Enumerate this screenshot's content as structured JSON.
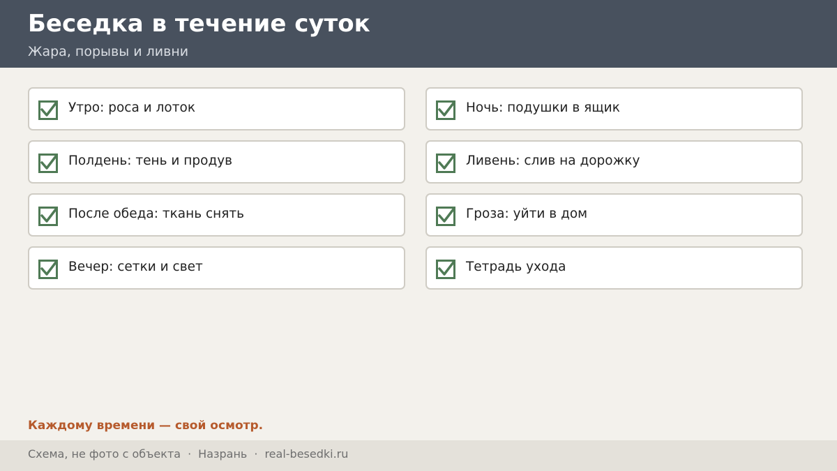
{
  "header": {
    "title": "Беседка в течение суток",
    "subtitle": "Жара, порывы и ливни"
  },
  "checklist": {
    "left": [
      {
        "label": "Утро: роса и лоток",
        "checked": true
      },
      {
        "label": "Полдень: тень и продув",
        "checked": true
      },
      {
        "label": "После обеда: ткань снять",
        "checked": true
      },
      {
        "label": "Вечер: сетки и свет",
        "checked": true
      }
    ],
    "right": [
      {
        "label": "Ночь: подушки в ящик",
        "checked": true
      },
      {
        "label": "Ливень: слив на дорожку",
        "checked": true
      },
      {
        "label": "Гроза: уйти в дом",
        "checked": true
      },
      {
        "label": "Тетрадь ухода",
        "checked": true
      }
    ]
  },
  "slogan": "Каждому времени — свой осмотр.",
  "footer": {
    "note": "Схема, не фото с объекта",
    "separator": "·",
    "city": "Назрань",
    "site": "real-besedki.ru"
  },
  "colors": {
    "header_bg": "#48515e",
    "check": "#4f7a55",
    "accent": "#b65a2c",
    "page_bg": "#f3f1ec"
  }
}
